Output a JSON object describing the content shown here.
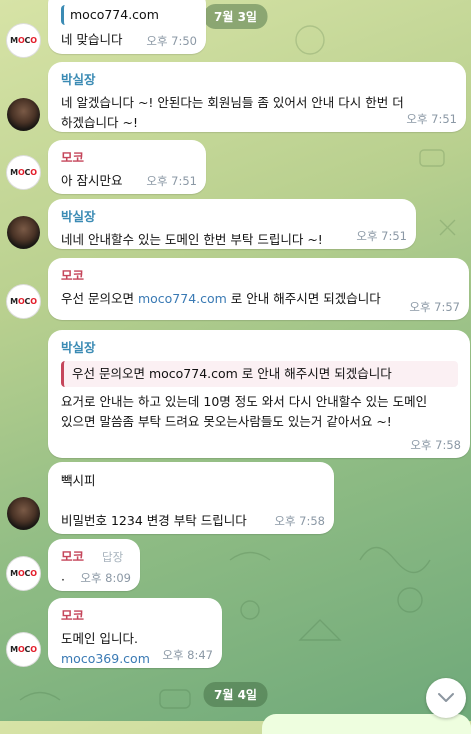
{
  "dates": {
    "top": "7월 3일",
    "bottom": "7월 4일"
  },
  "messages": [
    {
      "text": "moco774.com",
      "time": ""
    },
    {
      "text": "네 맞습니다",
      "time": "오후 7:50"
    },
    {
      "sender": "박실장",
      "text": "네 알겠습니다 ~! 안된다는 회원님들 좀 있어서 안내 다시 한번 더\n하겠습니다 ~!",
      "time": "오후 7:51"
    },
    {
      "sender": "모코",
      "text": "아 잠시만요",
      "time": "오후 7:51"
    },
    {
      "sender": "박실장",
      "text": "네네 안내할수 있는 도메인 한번 부탁 드립니다 ~!",
      "time": "오후 7:51"
    },
    {
      "sender": "모코",
      "text_before": "우선 문의오면 ",
      "link": "moco774.com",
      "text_after": " 로 안내 해주시면 되겠습니다",
      "time": "오후 7:57"
    },
    {
      "sender": "박실장",
      "quote_text": "우선 문의오면 moco774.com 로 안내 해주시면 되겠습니다",
      "text": "요거로 안내는 하고 있는데 10명 정도 와서 다시 안내할수 있는 도메인\n있으면 말씀좀 부탁 드려요 못오는사람들도 있는거 같아서요 ~!",
      "time": "오후 7:58"
    },
    {
      "line1": "빽시피",
      "line2": "비밀번호 1234 변경 부탁 드립니다",
      "time": "오후 7:58"
    },
    {
      "sender": "모코",
      "reply_label": "답장",
      "text": "·",
      "time": "오후 8:09"
    },
    {
      "sender": "모코",
      "text": "도메인 입니다.",
      "link": "moco369.com",
      "time": "오후 8:47"
    }
  ],
  "avatars": {
    "moco_logo": {
      "m": "M",
      "o1": "O",
      "c": "C",
      "o2": "O"
    }
  },
  "icons": {
    "scroll_down": "chevron-down-icon"
  }
}
